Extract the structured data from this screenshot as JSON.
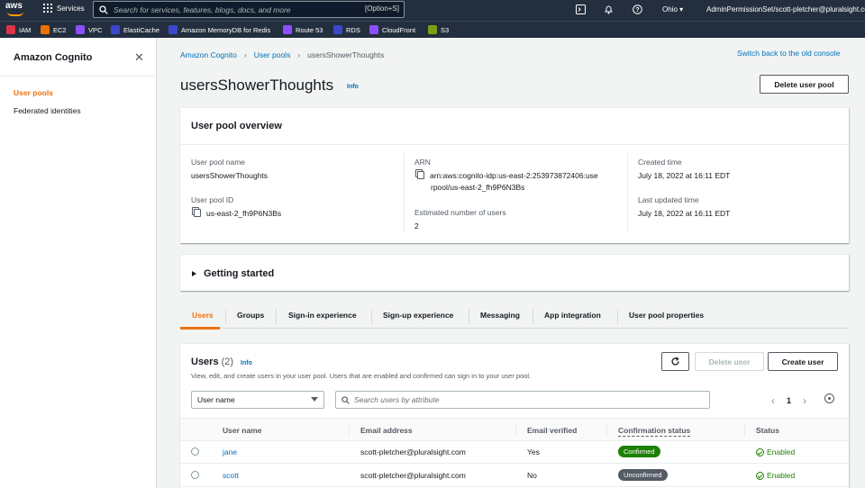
{
  "topnav": {
    "logo": "aws",
    "services_label": "Services",
    "search_placeholder": "Search for services, features, blogs, docs, and more",
    "search_shortcut": "[Option+S]",
    "region": "Ohio",
    "account": "AdminPermissionSet/scott-pletcher@pluralsight.com",
    "icons": [
      "cloudshell-icon",
      "bell-icon",
      "help-icon"
    ]
  },
  "favorites": [
    {
      "label": "IAM",
      "color": "#dd344c"
    },
    {
      "label": "EC2",
      "color": "#ed7100"
    },
    {
      "label": "VPC",
      "color": "#8c4fff"
    },
    {
      "label": "ElastiCache",
      "color": "#3b48cc"
    },
    {
      "label": "Amazon MemoryDB for Redis",
      "color": "#3b48cc"
    },
    {
      "label": "Route 53",
      "color": "#8c4fff"
    },
    {
      "label": "RDS",
      "color": "#3b48cc"
    },
    {
      "label": "CloudFront",
      "color": "#8c4fff"
    },
    {
      "label": "S3",
      "color": "#7aa116"
    }
  ],
  "sidebar": {
    "title": "Amazon Cognito",
    "items": [
      {
        "label": "User pools",
        "active": true
      },
      {
        "label": "Federated identities",
        "active": false
      }
    ]
  },
  "breadcrumb": [
    "Amazon Cognito",
    "User pools",
    "usersShowerThoughts"
  ],
  "switch_console": "Switch back to the old console",
  "page": {
    "title": "usersShowerThoughts",
    "info": "Info",
    "delete_pool": "Delete user pool"
  },
  "overview": {
    "heading": "User pool overview",
    "pool_name_label": "User pool name",
    "pool_name": "usersShowerThoughts",
    "pool_id_label": "User pool ID",
    "pool_id": "us-east-2_fh9P6N3Bs",
    "arn_label": "ARN",
    "arn_line1": "arn:aws:cognito-idp:us-east-2:253973872406:use",
    "arn_line2": "rpool/us-east-2_fh9P6N3Bs",
    "est_users_label": "Estimated number of users",
    "est_users": "2",
    "created_label": "Created time",
    "created": "July 18, 2022 at 16:11 EDT",
    "updated_label": "Last updated time",
    "updated": "July 18, 2022 at 16:11 EDT"
  },
  "getting_started": "Getting started",
  "tabs": [
    "Users",
    "Groups",
    "Sign-in experience",
    "Sign-up experience",
    "Messaging",
    "App integration",
    "User pool properties"
  ],
  "users": {
    "heading": "Users",
    "count": "(2)",
    "info": "Info",
    "description": "View, edit, and create users in your user pool. Users that are enabled and confirmed can sign in to your user pool.",
    "delete_user": "Delete user",
    "create_user": "Create user",
    "filter_value": "User name",
    "search_placeholder": "Search users by attribute",
    "page": "1",
    "columns": [
      "User name",
      "Email address",
      "Email verified",
      "Confirmation status",
      "Status"
    ],
    "rows": [
      {
        "name": "jane",
        "email": "scott-pletcher@pluralsight.com",
        "verified": "Yes",
        "confirmation": "Confirmed",
        "confirmation_color": "#1d8102",
        "status": "Enabled"
      },
      {
        "name": "scott",
        "email": "scott-pletcher@pluralsight.com",
        "verified": "No",
        "confirmation": "Unconfirmed",
        "confirmation_color": "#545b64",
        "status": "Enabled"
      }
    ]
  }
}
